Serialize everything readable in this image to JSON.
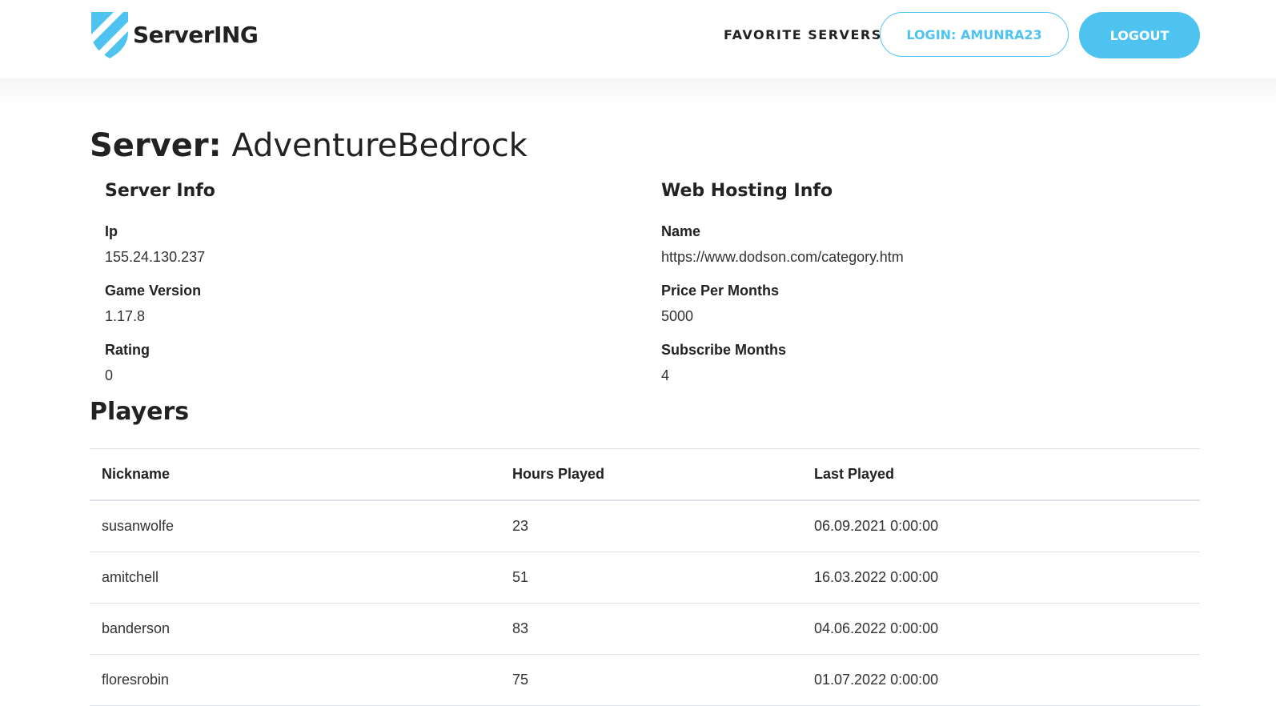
{
  "header": {
    "brand": "ServerING",
    "nav_favorites": "FAVORITE SERVERS",
    "login_label": "LOGIN: AMUNRA23",
    "logout_label": "LOGOUT"
  },
  "page": {
    "title_prefix": "Server:",
    "server_name": "AdventureBedrock"
  },
  "server_info": {
    "heading": "Server Info",
    "ip_label": "Ip",
    "ip_value": "155.24.130.237",
    "version_label": "Game Version",
    "version_value": "1.17.8",
    "rating_label": "Rating",
    "rating_value": "0"
  },
  "hosting_info": {
    "heading": "Web Hosting Info",
    "name_label": "Name",
    "name_value": "https://www.dodson.com/category.htm",
    "price_label": "Price Per Months",
    "price_value": "5000",
    "months_label": "Subscribe Months",
    "months_value": "4"
  },
  "players": {
    "heading": "Players",
    "columns": [
      "Nickname",
      "Hours Played",
      "Last Played"
    ],
    "rows": [
      [
        "susanwolfe",
        "23",
        "06.09.2021 0:00:00"
      ],
      [
        "amitchell",
        "51",
        "16.03.2022 0:00:00"
      ],
      [
        "banderson",
        "83",
        "04.06.2022 0:00:00"
      ],
      [
        "floresrobin",
        "75",
        "01.07.2022 0:00:00"
      ]
    ]
  },
  "colors": {
    "accent": "#4fc3ef",
    "text": "#222222",
    "divider": "#dee2e6"
  },
  "icons": {
    "logo": "shield-logo-icon"
  }
}
